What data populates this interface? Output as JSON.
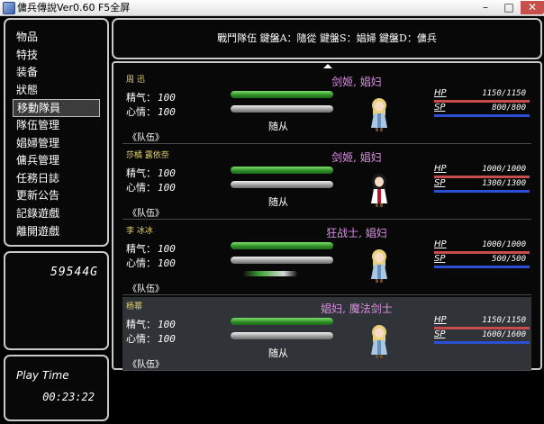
{
  "window": {
    "title": "傭兵傳說Ver0.60 F5全屏",
    "minimize": "–",
    "maximize": "□",
    "close": "✕",
    "icon": "app-icon"
  },
  "menu": {
    "items": [
      "物品",
      "特技",
      "装备",
      "狀態",
      "移動隊員",
      "隊伍管理",
      "娼婦管理",
      "傭兵管理",
      "任務日誌",
      "更新公告",
      "記錄遊戲",
      "離開遊戲"
    ],
    "selected_index": 4
  },
  "gold": {
    "value": "59544G"
  },
  "play_time": {
    "label": "Play Time",
    "value": "00:23:22"
  },
  "header": {
    "text": "戰鬥隊伍  鍵盤A：隨從   鍵盤S：娼婦  鍵盤D：傭兵"
  },
  "labels": {
    "mood_energy": "精气：",
    "mood_heart": "心情：",
    "hp": "HP",
    "sp": "SP"
  },
  "members": [
    {
      "name": "周 迅",
      "classes": "剑姬, 娼妇",
      "energy": "100",
      "heart": "100",
      "energy_fill": 1.0,
      "heart_fill": 1.0,
      "status": "随从",
      "team": "《队伍》",
      "hp": "1150/1150",
      "sp": "800/800",
      "hp_fill": 1.0,
      "sp_fill": 1.0,
      "portrait": "blonde-girl"
    },
    {
      "name": "莎橘 露依奈",
      "classes": "剑姬, 娼妇",
      "energy": "100",
      "heart": "100",
      "energy_fill": 1.0,
      "heart_fill": 1.0,
      "status": "随从",
      "team": "《队伍》",
      "hp": "1000/1000",
      "sp": "1300/1300",
      "hp_fill": 1.0,
      "sp_fill": 1.0,
      "portrait": "dark-haired-girl"
    },
    {
      "name": "李 冰冰",
      "classes": "狂战士, 娼妇",
      "energy": "100",
      "heart": "100",
      "energy_fill": 1.0,
      "heart_fill": 1.0,
      "status": "",
      "team": "《队伍》",
      "hp": "1000/1000",
      "sp": "500/500",
      "hp_fill": 1.0,
      "sp_fill": 1.0,
      "portrait": "blonde-girl"
    },
    {
      "name": "杨幂",
      "classes": "娼妇, 魔法剑士",
      "energy": "100",
      "heart": "100",
      "energy_fill": 1.0,
      "heart_fill": 1.0,
      "status": "随从",
      "team": "《队伍》",
      "hp": "1150/1150",
      "sp": "1600/1600",
      "hp_fill": 1.0,
      "sp_fill": 1.0,
      "portrait": "blonde-girl"
    }
  ],
  "colors": {
    "class_text": "#d78ee0",
    "name_text": "#e6d36a",
    "hp_gauge": "#c94c4c",
    "sp_gauge": "#2b50d6"
  }
}
